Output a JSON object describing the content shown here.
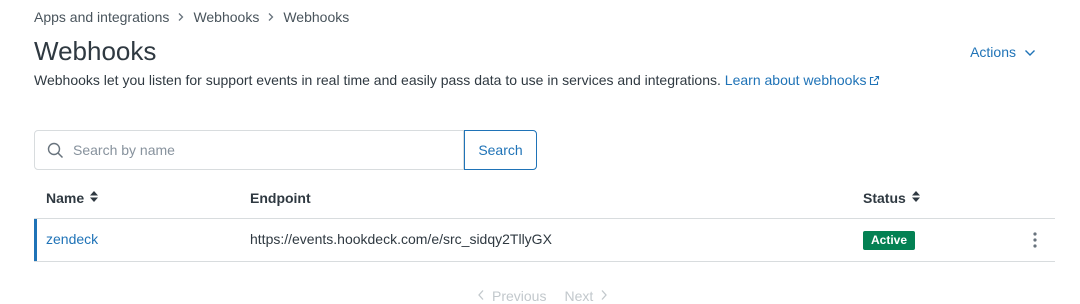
{
  "breadcrumb": {
    "items": [
      "Apps and integrations",
      "Webhooks",
      "Webhooks"
    ]
  },
  "header": {
    "title": "Webhooks",
    "actions_label": "Actions"
  },
  "description": {
    "text": "Webhooks let you listen for support events in real time and easily pass data to use in services and integrations.",
    "link_label": "Learn about webhooks"
  },
  "search": {
    "placeholder": "Search by name",
    "value": "",
    "button_label": "Search"
  },
  "table": {
    "columns": {
      "name": "Name",
      "endpoint": "Endpoint",
      "status": "Status"
    },
    "rows": [
      {
        "name": "zendeck",
        "endpoint": "https://events.hookdeck.com/e/src_sidqy2TllyGX",
        "status": "Active"
      }
    ]
  },
  "pagination": {
    "previous_label": "Previous",
    "next_label": "Next"
  },
  "colors": {
    "link": "#1f73b7",
    "active_badge": "#038153",
    "border": "#d8dcde",
    "text": "#2f3941"
  },
  "icons": [
    "chevron-right-icon",
    "chevron-down-icon",
    "external-link-icon",
    "search-icon",
    "sort-icon",
    "overflow-menu-icon",
    "chevron-left-icon"
  ]
}
